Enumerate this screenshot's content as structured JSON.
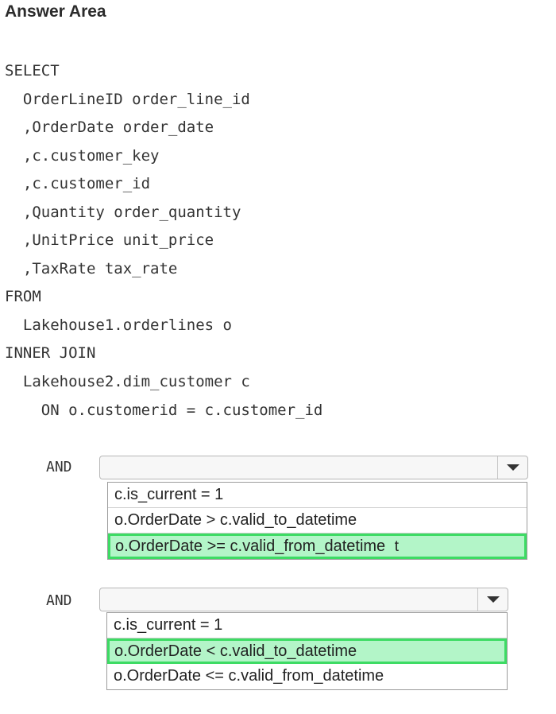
{
  "title": "Answer Area",
  "sql": [
    "SELECT",
    "  OrderLineID order_line_id",
    "  ,OrderDate order_date",
    "  ,c.customer_key",
    "  ,c.customer_id",
    "  ,Quantity order_quantity",
    "  ,UnitPrice unit_price",
    "  ,TaxRate tax_rate",
    "FROM",
    "  Lakehouse1.orderlines o",
    "INNER JOIN",
    "  Lakehouse2.dim_customer c",
    "    ON o.customerid = c.customer_id"
  ],
  "dropdown1": {
    "keyword": "AND",
    "value": "",
    "options": [
      "c.is_current = 1",
      "o.OrderDate > c.valid_to_datetime",
      "o.OrderDate >= c.valid_from_datetime"
    ],
    "selected_index": 2,
    "cursor_glyph": "t"
  },
  "dropdown2": {
    "keyword": "AND",
    "value": "",
    "options": [
      "c.is_current = 1",
      "o.OrderDate < c.valid_to_datetime",
      "o.OrderDate <= c.valid_from_datetime"
    ],
    "selected_index": 1
  },
  "icons": {
    "dropdown_arrow": "chevron-down-icon"
  },
  "colors": {
    "selected_fill": "#b3f5c8",
    "selected_border": "#3ddb64"
  }
}
